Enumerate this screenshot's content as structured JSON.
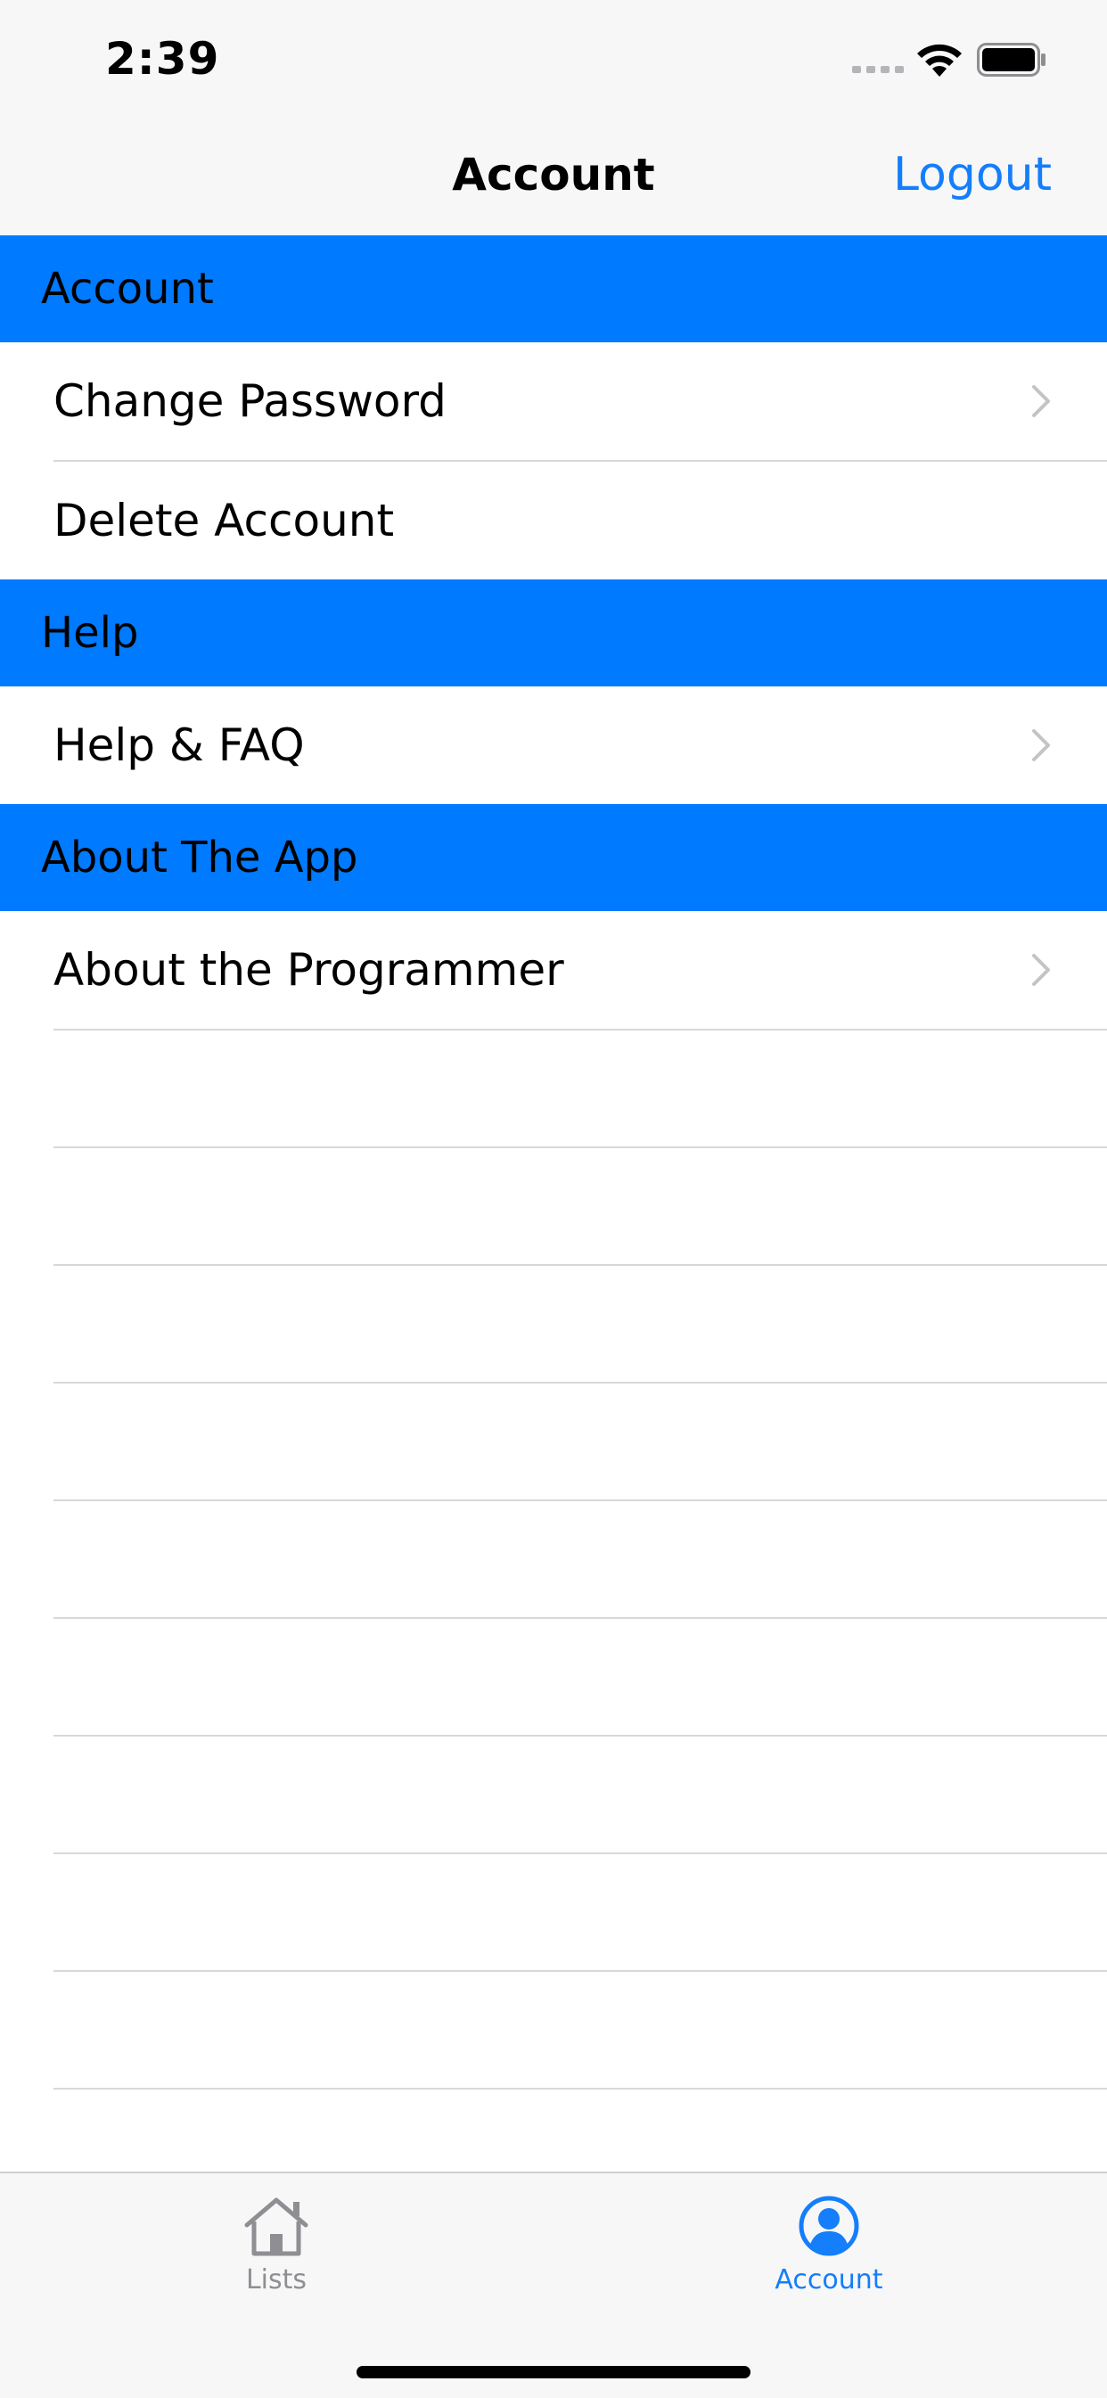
{
  "status_bar": {
    "time": "2:39"
  },
  "nav_bar": {
    "title": "Account",
    "logout_label": "Logout"
  },
  "sections": [
    {
      "header": "Account",
      "rows": [
        {
          "label": "Change Password",
          "chevron": true
        },
        {
          "label": "Delete Account",
          "chevron": false
        }
      ]
    },
    {
      "header": "Help",
      "rows": [
        {
          "label": "Help & FAQ",
          "chevron": true
        }
      ]
    },
    {
      "header": "About The App",
      "rows": [
        {
          "label": "About the Programmer",
          "chevron": true
        }
      ]
    }
  ],
  "tab_bar": {
    "tabs": [
      {
        "label": "Lists",
        "icon": "house-icon",
        "selected": false
      },
      {
        "label": "Account",
        "icon": "person-circle-icon",
        "selected": true
      }
    ]
  },
  "colors": {
    "accent": "#147efb",
    "section_header_bg": "#007aff",
    "inactive_tab": "#8e8e93",
    "separator": "#d8d8dc"
  }
}
